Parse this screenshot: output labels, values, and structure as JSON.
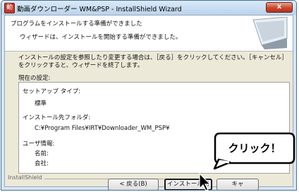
{
  "window": {
    "title": "動画ダウンローダー WM&PSP - InstallShield Wizard",
    "close_label": "x"
  },
  "header": {
    "title": "プログラムをインストールする準備ができました",
    "subtitle": "ウィザードは、インストールを開始する準備ができました。"
  },
  "body": {
    "instruction": "インストールの設定を参照したり変更する場合は、［戻る］をクリックしてください。［キャンセル］をクリックすると、ウィザードを終了します。",
    "current_settings_label": "現在の設定:"
  },
  "settings": {
    "setup_type_label": "セットアップ タイプ:",
    "setup_type_value": "標準",
    "install_folder_label": "インストール先フォルダ:",
    "install_folder_value": "C:¥Program Files¥IRT¥Downloader_WM_PSP¥",
    "user_info_label": "ユーザ情報:",
    "name_label": "名前:",
    "company_label": "会社:"
  },
  "footer": {
    "brand": "InstallShield",
    "back_button": "< 戻る(B)",
    "install_button": "インストール(I)",
    "cancel_button": "キャ"
  },
  "annotation": {
    "callout_text": "クリック！"
  }
}
